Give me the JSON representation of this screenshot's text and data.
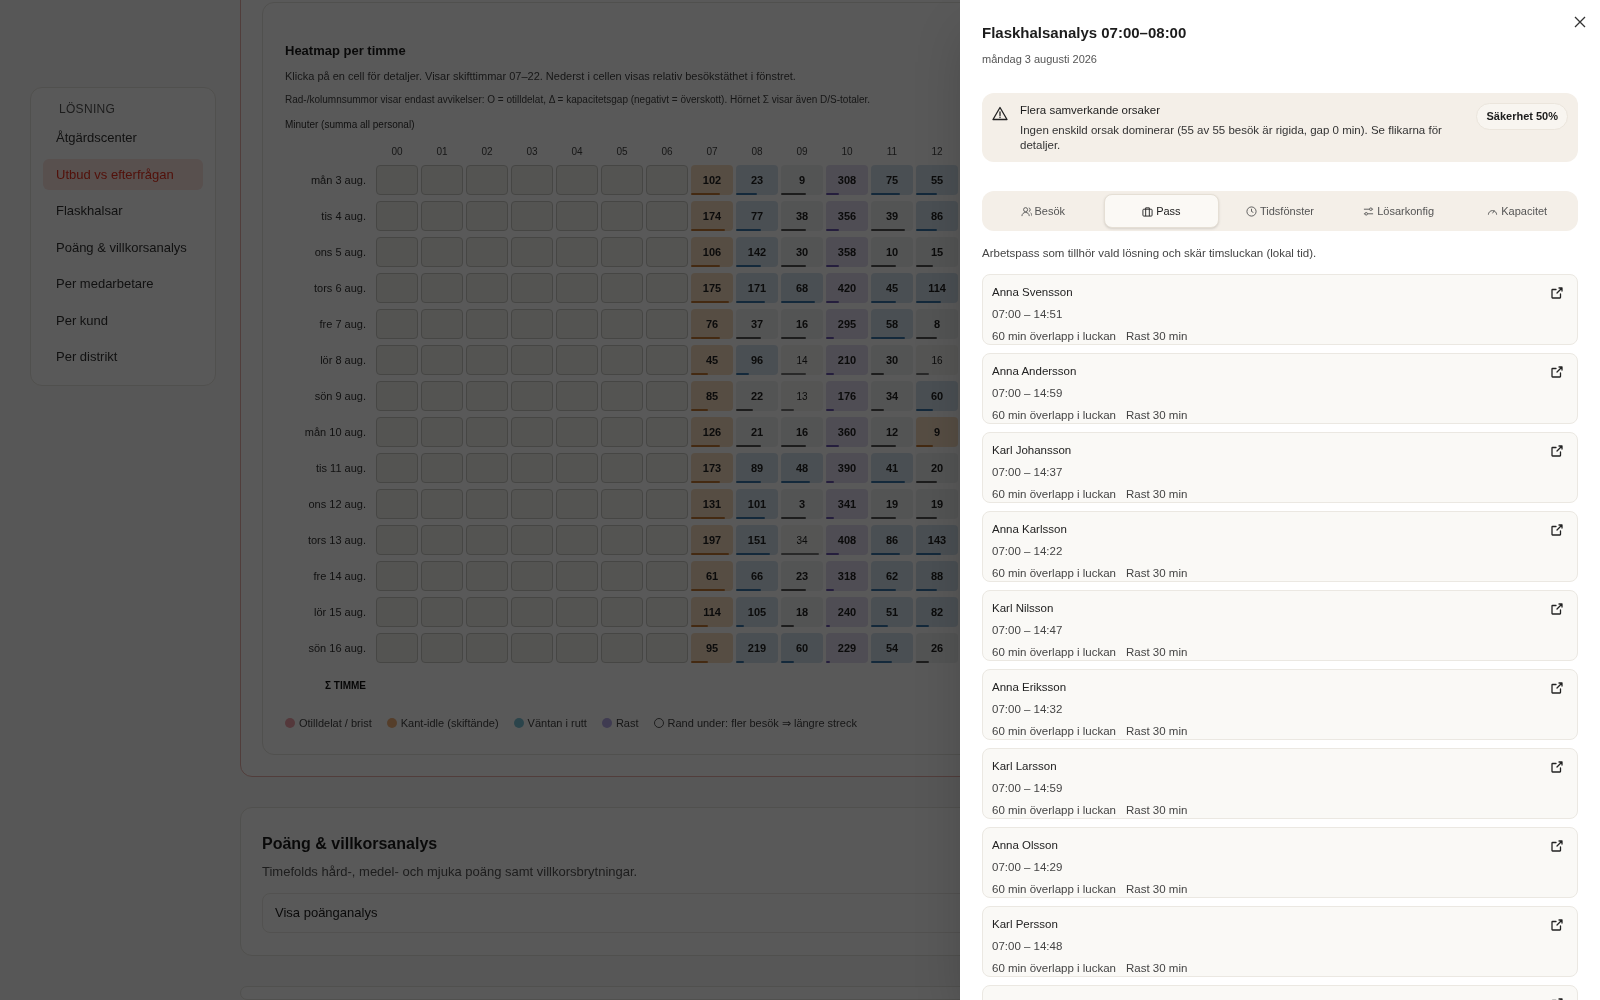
{
  "sidebar": {
    "heading": "LÖSNING",
    "items": [
      {
        "label": "Åtgärdscenter",
        "selected": false
      },
      {
        "label": "Utbud vs efterfrågan",
        "selected": true
      },
      {
        "label": "Flaskhalsar",
        "selected": false
      },
      {
        "label": "Poäng & villkorsanalys",
        "selected": false
      },
      {
        "label": "Per medarbetare",
        "selected": false
      },
      {
        "label": "Per kund",
        "selected": false
      },
      {
        "label": "Per distrikt",
        "selected": false
      }
    ]
  },
  "heatmap": {
    "title": "Heatmap per timme",
    "description": "Klicka på en cell för detaljer. Visar skifttimmar 07–22. Nederst i cellen visas relativ besökstäthet i fönstret.",
    "note": "Rad-/kolumnsummor visar endast avvikelser: O = otilldelat, Δ = kapacitetsgap (negativt = överskott). Hörnet Σ visar även D/S-totaler.",
    "unit": "Minuter (summa all personal)",
    "hours": [
      "00",
      "01",
      "02",
      "03",
      "04",
      "05",
      "06",
      "07",
      "08",
      "09",
      "10",
      "11",
      "12"
    ],
    "rows": [
      {
        "label": "mån 3 aug.",
        "cells": [
          {
            "kind": "empty"
          },
          {
            "kind": "empty"
          },
          {
            "kind": "empty"
          },
          {
            "kind": "empty"
          },
          {
            "kind": "empty"
          },
          {
            "kind": "empty"
          },
          {
            "kind": "empty"
          },
          {
            "value": "102",
            "kind": "idle",
            "level": 0.7
          },
          {
            "value": "23",
            "kind": "wait",
            "level": 0.5
          },
          {
            "value": "9",
            "kind": "none",
            "level": 0.6
          },
          {
            "value": "308",
            "kind": "break",
            "level": 0.3
          },
          {
            "value": "75",
            "kind": "wait",
            "level": 0.7
          },
          {
            "value": "55",
            "kind": "wait",
            "level": 0.5
          }
        ]
      },
      {
        "label": "tis 4 aug.",
        "cells": [
          {
            "kind": "empty"
          },
          {
            "kind": "empty"
          },
          {
            "kind": "empty"
          },
          {
            "kind": "empty"
          },
          {
            "kind": "empty"
          },
          {
            "kind": "empty"
          },
          {
            "kind": "empty"
          },
          {
            "value": "174",
            "kind": "idle",
            "level": 0.8
          },
          {
            "value": "77",
            "kind": "wait",
            "level": 0.6
          },
          {
            "value": "38",
            "kind": "none",
            "level": 0.6
          },
          {
            "value": "356",
            "kind": "break",
            "level": 0.3
          },
          {
            "value": "39",
            "kind": "none",
            "level": 0.8
          },
          {
            "value": "86",
            "kind": "wait",
            "level": 0.5
          }
        ]
      },
      {
        "label": "ons 5 aug.",
        "cells": [
          {
            "kind": "empty"
          },
          {
            "kind": "empty"
          },
          {
            "kind": "empty"
          },
          {
            "kind": "empty"
          },
          {
            "kind": "empty"
          },
          {
            "kind": "empty"
          },
          {
            "kind": "empty"
          },
          {
            "value": "106",
            "kind": "idle",
            "level": 0.7
          },
          {
            "value": "142",
            "kind": "wait",
            "level": 0.6
          },
          {
            "value": "30",
            "kind": "none",
            "level": 0.6
          },
          {
            "value": "358",
            "kind": "break",
            "level": 0.3
          },
          {
            "value": "10",
            "kind": "none",
            "level": 0.6
          },
          {
            "value": "15",
            "kind": "none",
            "level": 0.4
          }
        ]
      },
      {
        "label": "tors 6 aug.",
        "cells": [
          {
            "kind": "empty"
          },
          {
            "kind": "empty"
          },
          {
            "kind": "empty"
          },
          {
            "kind": "empty"
          },
          {
            "kind": "empty"
          },
          {
            "kind": "empty"
          },
          {
            "kind": "empty"
          },
          {
            "value": "175",
            "kind": "idle",
            "level": 0.9
          },
          {
            "value": "171",
            "kind": "wait",
            "level": 0.7
          },
          {
            "value": "68",
            "kind": "wait",
            "level": 0.8
          },
          {
            "value": "420",
            "kind": "break",
            "level": 0.3
          },
          {
            "value": "45",
            "kind": "wait",
            "level": 0.6
          },
          {
            "value": "114",
            "kind": "wait",
            "level": 0.6
          }
        ]
      },
      {
        "label": "fre 7 aug.",
        "cells": [
          {
            "kind": "empty"
          },
          {
            "kind": "empty"
          },
          {
            "kind": "empty"
          },
          {
            "kind": "empty"
          },
          {
            "kind": "empty"
          },
          {
            "kind": "empty"
          },
          {
            "kind": "empty"
          },
          {
            "value": "76",
            "kind": "idle",
            "level": 0.7
          },
          {
            "value": "37",
            "kind": "none",
            "level": 0.6
          },
          {
            "value": "16",
            "kind": "none",
            "level": 0.6
          },
          {
            "value": "295",
            "kind": "break",
            "level": 0.2
          },
          {
            "value": "58",
            "kind": "wait",
            "level": 0.8
          },
          {
            "value": "8",
            "kind": "none",
            "level": 0.5
          }
        ]
      },
      {
        "label": "lör 8 aug.",
        "cells": [
          {
            "kind": "empty"
          },
          {
            "kind": "empty"
          },
          {
            "kind": "empty"
          },
          {
            "kind": "empty"
          },
          {
            "kind": "empty"
          },
          {
            "kind": "empty"
          },
          {
            "kind": "empty"
          },
          {
            "value": "45",
            "kind": "idle",
            "level": 0.4
          },
          {
            "value": "96",
            "kind": "wait",
            "level": 0.3
          },
          {
            "value": "14",
            "kind": "low",
            "level": 0.6
          },
          {
            "value": "210",
            "kind": "break",
            "level": 0.2
          },
          {
            "value": "30",
            "kind": "none",
            "level": 0.3
          },
          {
            "value": "16",
            "kind": "low",
            "level": 0.3
          }
        ]
      },
      {
        "label": "sön 9 aug.",
        "cells": [
          {
            "kind": "empty"
          },
          {
            "kind": "empty"
          },
          {
            "kind": "empty"
          },
          {
            "kind": "empty"
          },
          {
            "kind": "empty"
          },
          {
            "kind": "empty"
          },
          {
            "kind": "empty"
          },
          {
            "value": "85",
            "kind": "idle",
            "level": 0.4
          },
          {
            "value": "22",
            "kind": "none",
            "level": 0.4
          },
          {
            "value": "13",
            "kind": "low",
            "level": 0.3
          },
          {
            "value": "176",
            "kind": "break",
            "level": 0.2
          },
          {
            "value": "34",
            "kind": "none",
            "level": 0.3
          },
          {
            "value": "60",
            "kind": "wait",
            "level": 0.4
          }
        ]
      },
      {
        "label": "mån 10 aug.",
        "cells": [
          {
            "kind": "empty"
          },
          {
            "kind": "empty"
          },
          {
            "kind": "empty"
          },
          {
            "kind": "empty"
          },
          {
            "kind": "empty"
          },
          {
            "kind": "empty"
          },
          {
            "kind": "empty"
          },
          {
            "value": "126",
            "kind": "idle",
            "level": 0.7
          },
          {
            "value": "21",
            "kind": "none",
            "level": 0.6
          },
          {
            "value": "16",
            "kind": "none",
            "level": 0.6
          },
          {
            "value": "360",
            "kind": "break",
            "level": 0.3
          },
          {
            "value": "12",
            "kind": "none",
            "level": 0.6
          },
          {
            "value": "9",
            "kind": "idle",
            "level": 0.4
          }
        ]
      },
      {
        "label": "tis 11 aug.",
        "cells": [
          {
            "kind": "empty"
          },
          {
            "kind": "empty"
          },
          {
            "kind": "empty"
          },
          {
            "kind": "empty"
          },
          {
            "kind": "empty"
          },
          {
            "kind": "empty"
          },
          {
            "kind": "empty"
          },
          {
            "value": "173",
            "kind": "idle",
            "level": 0.7
          },
          {
            "value": "89",
            "kind": "wait",
            "level": 0.6
          },
          {
            "value": "48",
            "kind": "wait",
            "level": 0.7
          },
          {
            "value": "390",
            "kind": "break",
            "level": 0.2
          },
          {
            "value": "41",
            "kind": "wait",
            "level": 0.8
          },
          {
            "value": "20",
            "kind": "none",
            "level": 0.5
          }
        ]
      },
      {
        "label": "ons 12 aug.",
        "cells": [
          {
            "kind": "empty"
          },
          {
            "kind": "empty"
          },
          {
            "kind": "empty"
          },
          {
            "kind": "empty"
          },
          {
            "kind": "empty"
          },
          {
            "kind": "empty"
          },
          {
            "kind": "empty"
          },
          {
            "value": "131",
            "kind": "idle",
            "level": 0.8
          },
          {
            "value": "101",
            "kind": "wait",
            "level": 0.7
          },
          {
            "value": "3",
            "kind": "none",
            "level": 0.6
          },
          {
            "value": "341",
            "kind": "break",
            "level": 0.2
          },
          {
            "value": "19",
            "kind": "none",
            "level": 0.6
          },
          {
            "value": "19",
            "kind": "none",
            "level": 0.5
          }
        ]
      },
      {
        "label": "tors 13 aug.",
        "cells": [
          {
            "kind": "empty"
          },
          {
            "kind": "empty"
          },
          {
            "kind": "empty"
          },
          {
            "kind": "empty"
          },
          {
            "kind": "empty"
          },
          {
            "kind": "empty"
          },
          {
            "kind": "empty"
          },
          {
            "value": "197",
            "kind": "idle",
            "level": 0.9
          },
          {
            "value": "151",
            "kind": "wait",
            "level": 0.8
          },
          {
            "value": "34",
            "kind": "low",
            "level": 0.9
          },
          {
            "value": "408",
            "kind": "break",
            "level": 0.3
          },
          {
            "value": "86",
            "kind": "wait",
            "level": 0.7
          },
          {
            "value": "143",
            "kind": "wait",
            "level": 0.6
          }
        ]
      },
      {
        "label": "fre 14 aug.",
        "cells": [
          {
            "kind": "empty"
          },
          {
            "kind": "empty"
          },
          {
            "kind": "empty"
          },
          {
            "kind": "empty"
          },
          {
            "kind": "empty"
          },
          {
            "kind": "empty"
          },
          {
            "kind": "empty"
          },
          {
            "value": "61",
            "kind": "idle",
            "level": 0.8
          },
          {
            "value": "66",
            "kind": "wait",
            "level": 0.6
          },
          {
            "value": "23",
            "kind": "none",
            "level": 0.6
          },
          {
            "value": "318",
            "kind": "break",
            "level": 0.2
          },
          {
            "value": "62",
            "kind": "wait",
            "level": 0.6
          },
          {
            "value": "88",
            "kind": "wait",
            "level": 0.5
          }
        ]
      },
      {
        "label": "lör 15 aug.",
        "cells": [
          {
            "kind": "empty"
          },
          {
            "kind": "empty"
          },
          {
            "kind": "empty"
          },
          {
            "kind": "empty"
          },
          {
            "kind": "empty"
          },
          {
            "kind": "empty"
          },
          {
            "kind": "empty"
          },
          {
            "value": "114",
            "kind": "idle",
            "level": 0.4
          },
          {
            "value": "105",
            "kind": "wait",
            "level": 0.2
          },
          {
            "value": "18",
            "kind": "none",
            "level": 0.3
          },
          {
            "value": "240",
            "kind": "break",
            "level": 0.1
          },
          {
            "value": "51",
            "kind": "wait",
            "level": 0.4
          },
          {
            "value": "82",
            "kind": "wait",
            "level": 0.3
          }
        ]
      },
      {
        "label": "sön 16 aug.",
        "cells": [
          {
            "kind": "empty"
          },
          {
            "kind": "empty"
          },
          {
            "kind": "empty"
          },
          {
            "kind": "empty"
          },
          {
            "kind": "empty"
          },
          {
            "kind": "empty"
          },
          {
            "kind": "empty"
          },
          {
            "value": "95",
            "kind": "idle",
            "level": 0.4
          },
          {
            "value": "219",
            "kind": "wait",
            "level": 0.2
          },
          {
            "value": "60",
            "kind": "wait",
            "level": 0.3
          },
          {
            "value": "229",
            "kind": "break",
            "level": 0.1
          },
          {
            "value": "54",
            "kind": "wait",
            "level": 0.5
          },
          {
            "value": "26",
            "kind": "none",
            "level": 0.3
          }
        ]
      }
    ],
    "sum_label": "Σ TIMME",
    "legend": [
      {
        "label": "Otilldelat / brist",
        "kind": "unassigned"
      },
      {
        "label": "Kant-idle (skiftände)",
        "kind": "idle"
      },
      {
        "label": "Väntan i rutt",
        "kind": "wait"
      },
      {
        "label": "Rast",
        "kind": "break"
      },
      {
        "label": "Rand under: fler besök ⇒ längre streck",
        "kind": "ring"
      }
    ]
  },
  "score_section": {
    "title": "Poäng & villkorsanalys",
    "description": "Timefolds hård-, medel- och mjuka poäng samt villkorsbrytningar.",
    "button": "Visa poänganalys"
  },
  "drawer": {
    "title": "Flaskhalsanalys 07:00–08:00",
    "date": "måndag 3 augusti 2026",
    "alert": {
      "title": "Flera samverkande orsaker",
      "text": "Ingen enskild orsak dominerar (55 av 55 besök är rigida, gap 0 min). Se flikarna för detaljer.",
      "badge": "Säkerhet 50%"
    },
    "tabs": [
      {
        "label": "Besök",
        "selected": false
      },
      {
        "label": "Pass",
        "selected": true
      },
      {
        "label": "Tidsfönster",
        "selected": false
      },
      {
        "label": "Lösarkonfig",
        "selected": false
      },
      {
        "label": "Kapacitet",
        "selected": false
      }
    ],
    "description": "Arbetspass som tillhör vald lösning och skär timsluckan (lokal tid).",
    "shifts": [
      {
        "name": "Anna Svensson",
        "time": "07:00 – 14:51",
        "overlap": "60 min överlapp i luckan",
        "break": "Rast 30 min"
      },
      {
        "name": "Anna Andersson",
        "time": "07:00 – 14:59",
        "overlap": "60 min överlapp i luckan",
        "break": "Rast 30 min"
      },
      {
        "name": "Karl Johansson",
        "time": "07:00 – 14:37",
        "overlap": "60 min överlapp i luckan",
        "break": "Rast 30 min"
      },
      {
        "name": "Anna Karlsson",
        "time": "07:00 – 14:22",
        "overlap": "60 min överlapp i luckan",
        "break": "Rast 30 min"
      },
      {
        "name": "Karl Nilsson",
        "time": "07:00 – 14:47",
        "overlap": "60 min överlapp i luckan",
        "break": "Rast 30 min"
      },
      {
        "name": "Anna Eriksson",
        "time": "07:00 – 14:32",
        "overlap": "60 min överlapp i luckan",
        "break": "Rast 30 min"
      },
      {
        "name": "Karl Larsson",
        "time": "07:00 – 14:59",
        "overlap": "60 min överlapp i luckan",
        "break": "Rast 30 min"
      },
      {
        "name": "Anna Olsson",
        "time": "07:00 – 14:29",
        "overlap": "60 min överlapp i luckan",
        "break": "Rast 30 min"
      },
      {
        "name": "Karl Persson",
        "time": "07:00 – 14:48",
        "overlap": "60 min överlapp i luckan",
        "break": "Rast 30 min"
      }
    ]
  }
}
